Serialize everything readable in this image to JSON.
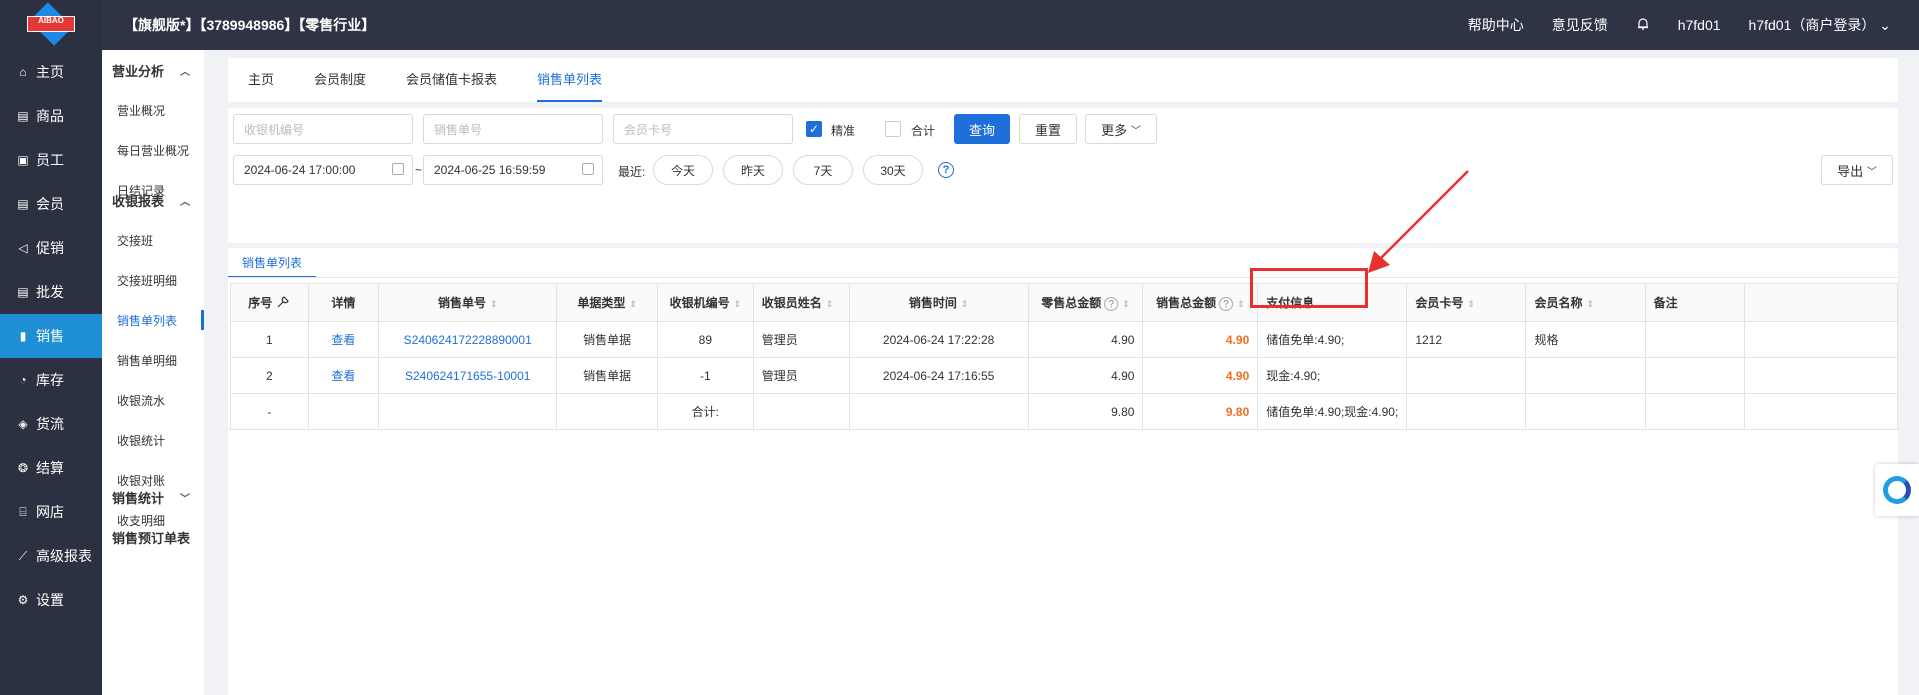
{
  "logo": {
    "text": "AIBAO"
  },
  "leftnav": [
    {
      "label": "主页",
      "icon": "home-icon",
      "glyph": "⌂"
    },
    {
      "label": "商品",
      "icon": "box-icon",
      "glyph": "▤"
    },
    {
      "label": "员工",
      "icon": "user-icon",
      "glyph": "▣"
    },
    {
      "label": "会员",
      "icon": "member-icon",
      "glyph": "▤"
    },
    {
      "label": "促销",
      "icon": "megaphone-icon",
      "glyph": "◁"
    },
    {
      "label": "批发",
      "icon": "wholesale-icon",
      "glyph": "▤"
    },
    {
      "label": "销售",
      "icon": "chart-icon",
      "glyph": "▮"
    },
    {
      "label": "库存",
      "icon": "stock-icon",
      "glyph": "◔"
    },
    {
      "label": "货流",
      "icon": "flow-icon",
      "glyph": "◈"
    },
    {
      "label": "结算",
      "icon": "settle-icon",
      "glyph": "❂"
    },
    {
      "label": "网店",
      "icon": "shop-icon",
      "glyph": "⌸"
    },
    {
      "label": "高级报表",
      "icon": "report-icon",
      "glyph": "⟋"
    },
    {
      "label": "设置",
      "icon": "gear-icon",
      "glyph": "⚙"
    }
  ],
  "topbar": {
    "title": "【旗舰版*】【3789948986】【零售行业】",
    "help": "帮助中心",
    "feedback": "意见反馈",
    "bell": "🔔",
    "user": "h7fd01",
    "account": "h7fd01（商户登录）"
  },
  "subnav": {
    "g1": "营业分析",
    "g1_items": [
      "营业概况",
      "每日营业概况",
      "日结记录"
    ],
    "g2": "收银报表",
    "g2_items": [
      "交接班",
      "交接班明细",
      "销售单列表",
      "销售单明细",
      "收银流水",
      "收银统计",
      "收银对账",
      "收支明细"
    ],
    "g3": "销售统计",
    "g4": "销售预订单表"
  },
  "tabs": [
    "主页",
    "会员制度",
    "会员储值卡报表",
    "销售单列表"
  ],
  "filter": {
    "pos_placeholder": "收银机编号",
    "order_placeholder": "销售单号",
    "card_placeholder": "会员卡号",
    "exact": "精准",
    "total": "合计",
    "query": "查询",
    "reset": "重置",
    "more": "更多",
    "start": "2024-06-24 17:00:00",
    "tilde": "~",
    "end": "2024-06-25 16:59:59",
    "recent": "最近:",
    "today": "今天",
    "yesterday": "昨天",
    "d7": "7天",
    "d30": "30天",
    "export": "导出"
  },
  "subtab": "销售单列表",
  "table": {
    "headers": [
      "序号",
      "详情",
      "销售单号",
      "单据类型",
      "收银机编号",
      "收银员姓名",
      "销售时间",
      "零售总金额",
      "销售总金额",
      "支付信息",
      "会员卡号",
      "会员名称",
      "备注"
    ],
    "rows": [
      [
        "1",
        "查看",
        "S240624172228890001",
        "销售单据",
        "89",
        "管理员",
        "2024-06-24 17:22:28",
        "4.90",
        "4.90",
        "储值免单:4.90;",
        "1212",
        "规格",
        ""
      ],
      [
        "2",
        "查看",
        "S240624171655-10001",
        "销售单据",
        "-1",
        "管理员",
        "2024-06-24 17:16:55",
        "4.90",
        "4.90",
        "现金:4.90;",
        "",
        "",
        ""
      ],
      [
        "-",
        "",
        "",
        "",
        "合计:",
        "",
        "",
        "9.80",
        "9.80",
        "储值免单:4.90;现金:4.90;",
        "",
        "",
        ""
      ]
    ]
  }
}
